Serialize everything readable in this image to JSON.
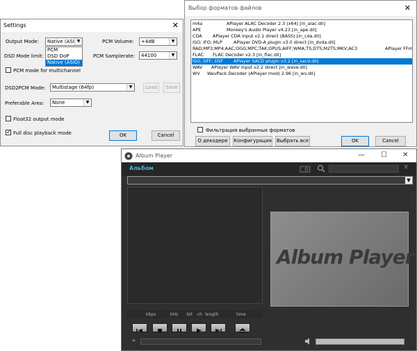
{
  "settings": {
    "title": "Settings",
    "output_mode_label": "Output Mode:",
    "output_mode_value": "Native (ASIO)",
    "output_mode_options": [
      "PCM",
      "DSD DoP",
      "Native (ASIO)"
    ],
    "pcm_volume_label": "PCM Volume:",
    "pcm_volume_value": "+4dB",
    "dsd_mode_limit_label": "DSD Mode limit:",
    "pcm_samplerate_label": "PCM Samplerate:",
    "pcm_samplerate_value": "44100",
    "pcm_multichannel_label": "PCM mode for multichannel",
    "dsd2pcm_label": "DSD2PCM Mode:",
    "dsd2pcm_value": "Multistage (64fp)",
    "load_label": "Load",
    "save_label": "Save",
    "preferable_area_label": "Preferable Area:",
    "preferable_area_value": "None",
    "float32_label": "Float32 output mode",
    "full_disc_label": "Full disc playback mode",
    "ok_label": "OK",
    "cancel_label": "Cancel"
  },
  "formats": {
    "title": "Выбор форматов файлов",
    "rows": [
      {
        "ext": "m4a",
        "desc": "APlayer ALAC Decoder 2.3 (x64)  [in_alac.dll]",
        "selected": false
      },
      {
        "ext": "APE",
        "desc": "Monkey's Audio Player v4.23  [in_ape.dll]",
        "selected": false
      },
      {
        "ext": "CDA",
        "desc": "APlayer CDA input v2.1 direct (BASS)  [in_cda.dll]",
        "selected": false
      },
      {
        "ext": "ISO; IFO; MLP",
        "desc": "APlayer DVD-A plugin v3.0 direct  [in_dvda.dll]",
        "selected": false
      },
      {
        "ext": "RAD;MP3;MP4;AAC;OGG;MPC;TAK;OPUS;AIFF;WMA;TS;DTS;M2TS;MKV;AC3",
        "desc": "APlayer FFm",
        "selected": false
      },
      {
        "ext": "FLAC",
        "desc": "FLAC Decoder v2.3  [in_flac.dll]",
        "selected": false
      },
      {
        "ext": "ISO; DFF; DSF",
        "desc": "APlayer SACD plugin v3.2  [in_sacd.dll]",
        "selected": true
      },
      {
        "ext": "WAV",
        "desc": "APlayer WAV input v2.2 direct  [in_wave.dll]",
        "selected": false
      },
      {
        "ext": "WV",
        "desc": "WavPack Decoder (APlayer mod) 2.96  [in_wv.dll]",
        "selected": false
      }
    ],
    "filter_label": "Фильтрация выбранных форматов",
    "about_label": "О декодере",
    "config_label": "Конфигурация",
    "select_all_label": "Выбрать все",
    "ok_label": "OK",
    "cancel_label": "Cancel"
  },
  "album": {
    "title": "Album Player",
    "album_label": "Альбом",
    "logo_text": "Album Player",
    "kbps_label": "kbps",
    "khz_label": "kHz",
    "bit_label": "bit",
    "ch_label": "ch",
    "length_label": "length",
    "time_label": "time"
  }
}
